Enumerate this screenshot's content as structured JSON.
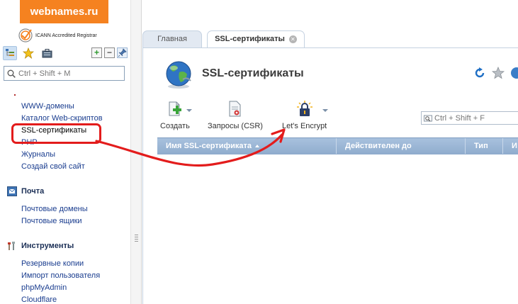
{
  "brand": {
    "logo_text": "webnames.ru",
    "accreditation": "ICANN Accredited Registrar",
    "logo_color": "#f58220"
  },
  "left_search": {
    "placeholder": "Ctrl + Shift + M"
  },
  "nav": {
    "websites": [
      {
        "label": "WWW-домены"
      },
      {
        "label": "Каталог Web-скриптов"
      },
      {
        "label": "SSL-сертификаты",
        "selected": true
      },
      {
        "label": "PHP"
      },
      {
        "label": "Журналы"
      },
      {
        "label": "Создай свой сайт"
      }
    ],
    "mail": {
      "title": "Почта",
      "items": [
        {
          "label": "Почтовые домены"
        },
        {
          "label": "Почтовые ящики"
        }
      ]
    },
    "tools": {
      "title": "Инструменты",
      "items": [
        {
          "label": "Резервные копии"
        },
        {
          "label": "Импорт пользователя"
        },
        {
          "label": "phpMyAdmin"
        },
        {
          "label": "Cloudflare"
        }
      ]
    }
  },
  "tabs": [
    {
      "label": "Главная",
      "active": false
    },
    {
      "label": "SSL-сертификаты",
      "active": true
    }
  ],
  "page": {
    "title": "SSL-сертификаты"
  },
  "actions": [
    {
      "label": "Создать",
      "icon": "create-icon",
      "has_dropdown": true
    },
    {
      "label": "Запросы (CSR)",
      "icon": "csr-icon",
      "has_dropdown": false
    },
    {
      "label": "Let's Encrypt",
      "icon": "lock-icon",
      "has_dropdown": true
    }
  ],
  "grid_search": {
    "placeholder": "Ctrl + Shift + F"
  },
  "table": {
    "columns": [
      {
        "label": "Имя SSL-сертификата",
        "sorted": "asc"
      },
      {
        "label": "Действителен до"
      },
      {
        "label": "Тип"
      },
      {
        "label": "И"
      }
    ]
  },
  "colors": {
    "annotation": "#e31c1c",
    "link": "#1a3d8f",
    "grid_header": "#9bb6d6"
  }
}
